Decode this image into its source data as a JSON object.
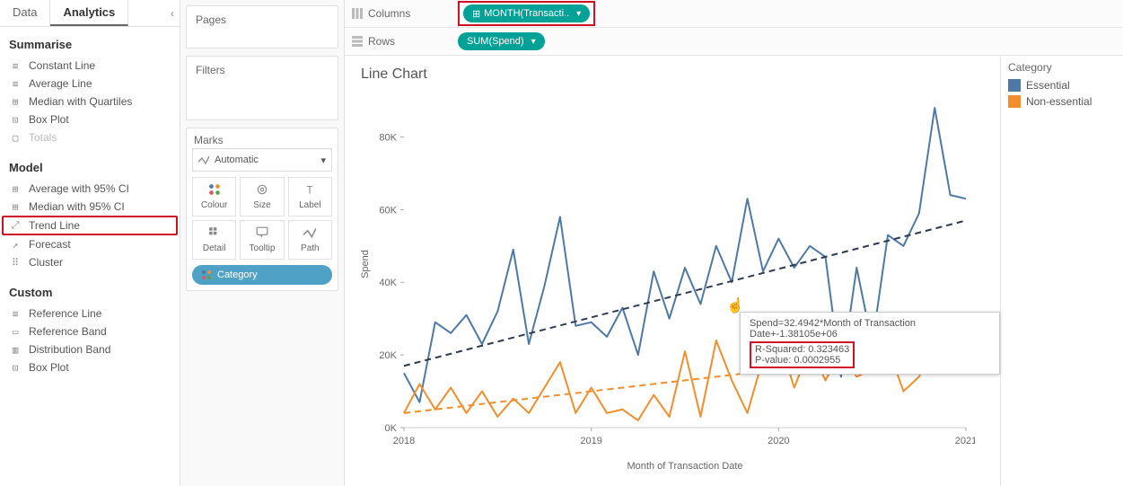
{
  "tabs": {
    "data": "Data",
    "analytics": "Analytics"
  },
  "summarise": {
    "title": "Summarise",
    "items": [
      {
        "icon": "≡",
        "label": "Constant Line"
      },
      {
        "icon": "≡",
        "label": "Average Line"
      },
      {
        "icon": "⊞",
        "label": "Median with Quartiles"
      },
      {
        "icon": "⊡",
        "label": "Box Plot"
      },
      {
        "icon": "▢",
        "label": "Totals",
        "disabled": true
      }
    ]
  },
  "model": {
    "title": "Model",
    "items": [
      {
        "icon": "⊞",
        "label": "Average with 95% CI"
      },
      {
        "icon": "⊞",
        "label": "Median with 95% CI"
      },
      {
        "icon": "⤢",
        "label": "Trend Line",
        "highlight": true
      },
      {
        "icon": "↗",
        "label": "Forecast"
      },
      {
        "icon": "⠿",
        "label": "Cluster"
      }
    ]
  },
  "custom": {
    "title": "Custom",
    "items": [
      {
        "icon": "≡",
        "label": "Reference Line"
      },
      {
        "icon": "▭",
        "label": "Reference Band"
      },
      {
        "icon": "▥",
        "label": "Distribution Band"
      },
      {
        "icon": "⊡",
        "label": "Box Plot"
      }
    ]
  },
  "pages_title": "Pages",
  "filters_title": "Filters",
  "marks": {
    "title": "Marks",
    "selected": "Automatic",
    "cells": [
      "Colour",
      "Size",
      "Label",
      "Detail",
      "Tooltip",
      "Path"
    ],
    "category_pill": "Category"
  },
  "shelves": {
    "columns_label": "Columns",
    "columns_pill": "MONTH(Transacti..",
    "rows_label": "Rows",
    "rows_pill": "SUM(Spend)"
  },
  "legend": {
    "title": "Category",
    "items": [
      {
        "label": "Essential",
        "color": "#4e79a7"
      },
      {
        "label": "Non-essential",
        "color": "#f28e2b"
      }
    ]
  },
  "tooltip": {
    "line1": "Spend=32.4942*Month of Transaction Date+-1.38105e+06",
    "line2": "R-Squared: 0.323463",
    "line3": "P-value: 0.0002955"
  },
  "chart_data": {
    "type": "line",
    "title": "Line Chart",
    "xlabel": "Month of Transaction Date",
    "ylabel": "Spend",
    "x_ticks": [
      2018,
      2019,
      2020,
      2021
    ],
    "y_ticks": [
      0,
      20000,
      40000,
      60000,
      80000
    ],
    "ylim": [
      0,
      90000
    ],
    "x": [
      "2018-01",
      "2018-02",
      "2018-03",
      "2018-04",
      "2018-05",
      "2018-06",
      "2018-07",
      "2018-08",
      "2018-09",
      "2018-10",
      "2018-11",
      "2018-12",
      "2019-01",
      "2019-02",
      "2019-03",
      "2019-04",
      "2019-05",
      "2019-06",
      "2019-07",
      "2019-08",
      "2019-09",
      "2019-10",
      "2019-11",
      "2019-12",
      "2020-01",
      "2020-02",
      "2020-03",
      "2020-04",
      "2020-05",
      "2020-06",
      "2020-07",
      "2020-08",
      "2020-09",
      "2020-10",
      "2020-11",
      "2020-12",
      "2021-01"
    ],
    "series": [
      {
        "name": "Essential",
        "color": "#4e79a7",
        "values": [
          15000,
          7000,
          29000,
          26000,
          31000,
          23000,
          32000,
          49000,
          23000,
          39000,
          58000,
          28000,
          29000,
          25000,
          33000,
          20000,
          43000,
          30000,
          44000,
          34000,
          50000,
          40000,
          63000,
          43000,
          52000,
          44000,
          50000,
          47000,
          14000,
          44000,
          23000,
          53000,
          50000,
          59000,
          88000,
          64000,
          63000
        ]
      },
      {
        "name": "Non-essential",
        "color": "#f28e2b",
        "values": [
          4000,
          12000,
          5000,
          11000,
          4000,
          10000,
          3000,
          8000,
          4000,
          11000,
          18000,
          4000,
          11000,
          4000,
          5000,
          2000,
          9000,
          3000,
          21000,
          3000,
          24000,
          13000,
          4000,
          19000,
          25000,
          11000,
          22000,
          13000,
          21000,
          14000,
          16000,
          22000,
          10000,
          14000,
          24000,
          21000,
          21000
        ]
      }
    ],
    "trend_lines": [
      {
        "name": "Essential-trend",
        "color": "#2f3b52",
        "y_start": 17000,
        "y_end": 57000
      },
      {
        "name": "Non-essential-trend",
        "color": "#f28e2b",
        "y_start": 4000,
        "y_end": 22000
      }
    ]
  }
}
